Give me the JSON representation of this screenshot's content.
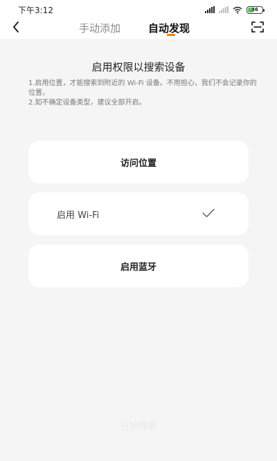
{
  "status_bar": {
    "time": "下午3:12",
    "battery": "36",
    "battery_color": "#5ac85a"
  },
  "header": {
    "back_icon": "chevron-left-icon",
    "tabs": [
      {
        "label": "手动添加",
        "active": false
      },
      {
        "label": "自动发现",
        "active": true
      }
    ],
    "scan_icon": "scan-icon",
    "accent_color": "#ff7a00"
  },
  "main": {
    "title": "启用权限以搜索设备",
    "desc_1": "1.启用位置，才能搜索到附近的 Wi-Fi 设备。不用担心，我们不会记录你的位置。",
    "desc_2": "2.如不确定设备类型，建议全部开启。",
    "options": [
      {
        "label": "访问位置",
        "enabled": false
      },
      {
        "label": "启用 Wi-Fi",
        "enabled": true
      },
      {
        "label": "启用蓝牙",
        "enabled": false
      }
    ],
    "start_label": "开始搜索"
  }
}
